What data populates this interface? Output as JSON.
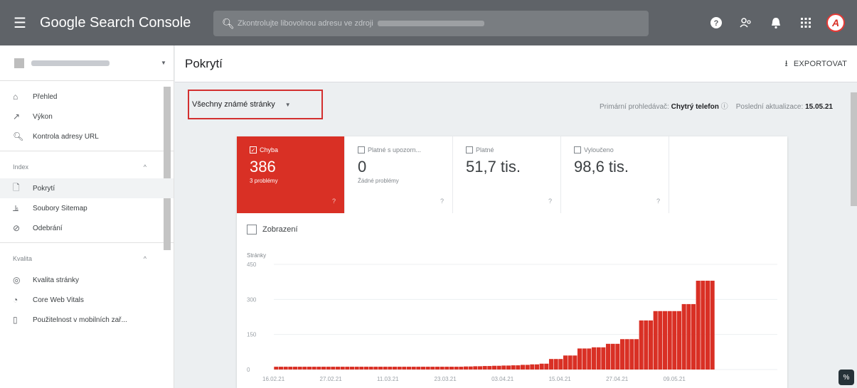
{
  "topbar": {
    "app_title": "Google Search Console",
    "search_placeholder": "Zkontrolujte libovolnou adresu ve zdroji",
    "avatar_letter": "A"
  },
  "sidebar": {
    "items_primary": [
      {
        "label": "Přehled",
        "icon": "home-icon"
      },
      {
        "label": "Výkon",
        "icon": "trend-icon"
      },
      {
        "label": "Kontrola adresy URL",
        "icon": "search-icon"
      }
    ],
    "section_index": "Index",
    "items_index": [
      {
        "label": "Pokrytí",
        "icon": "coverage-icon",
        "active": true
      },
      {
        "label": "Soubory Sitemap",
        "icon": "sitemap-icon"
      },
      {
        "label": "Odebrání",
        "icon": "removal-icon"
      }
    ],
    "section_quality": "Kvalita",
    "items_quality": [
      {
        "label": "Kvalita stránky",
        "icon": "quality-icon"
      },
      {
        "label": "Core Web Vitals",
        "icon": "gauge-icon"
      },
      {
        "label": "Použitelnost v mobilních zař...",
        "icon": "mobile-icon"
      }
    ]
  },
  "header": {
    "page_title": "Pokrytí",
    "export_label": "EXPORTOVAT"
  },
  "filter": {
    "selected": "Všechny známé stránky",
    "crawler_label": "Primární prohledávač:",
    "crawler_value": "Chytrý telefon",
    "updated_label": "Poslední aktualizace:",
    "updated_value": "15.05.21"
  },
  "tiles": [
    {
      "label": "Chyba",
      "value": "386",
      "sub": "3 problémy",
      "checked": true,
      "color": "#d93025"
    },
    {
      "label": "Platné s upozorn...",
      "value": "0",
      "sub": "Žádné problémy",
      "checked": false
    },
    {
      "label": "Platné",
      "value": "51,7 tis.",
      "sub": "",
      "checked": false
    },
    {
      "label": "Vyloučeno",
      "value": "98,6 tis.",
      "sub": "",
      "checked": false
    }
  ],
  "impressions_label": "Zobrazení",
  "chart_data": {
    "type": "bar",
    "ylabel": "Stránky",
    "ylim": [
      0,
      450
    ],
    "yticks": [
      0,
      150,
      300,
      450
    ],
    "xticks": [
      "16.02.21",
      "27.02.21",
      "11.03.21",
      "23.03.21",
      "03.04.21",
      "15.04.21",
      "27.04.21",
      "09.05.21"
    ],
    "color": "#d93025",
    "series": [
      {
        "values": [
          12,
          12,
          12,
          12,
          12,
          12,
          12,
          12,
          12,
          12,
          12,
          12,
          12,
          12,
          12,
          12,
          12,
          12,
          12,
          12,
          12,
          12,
          12,
          12,
          12,
          12,
          12,
          12,
          12,
          12,
          12,
          12,
          12,
          12,
          12,
          12,
          12,
          12,
          12,
          12,
          13,
          13,
          14,
          14,
          15,
          15,
          16,
          16,
          17,
          17,
          18,
          18,
          20,
          20,
          22,
          22,
          25,
          25,
          45,
          45,
          45,
          60,
          60,
          60,
          90,
          90,
          90,
          95,
          95,
          95,
          110,
          110,
          110,
          130,
          130,
          130,
          130,
          210,
          210,
          210,
          250,
          250,
          250,
          250,
          250,
          250,
          280,
          280,
          280,
          380,
          380,
          380,
          380
        ]
      }
    ]
  }
}
